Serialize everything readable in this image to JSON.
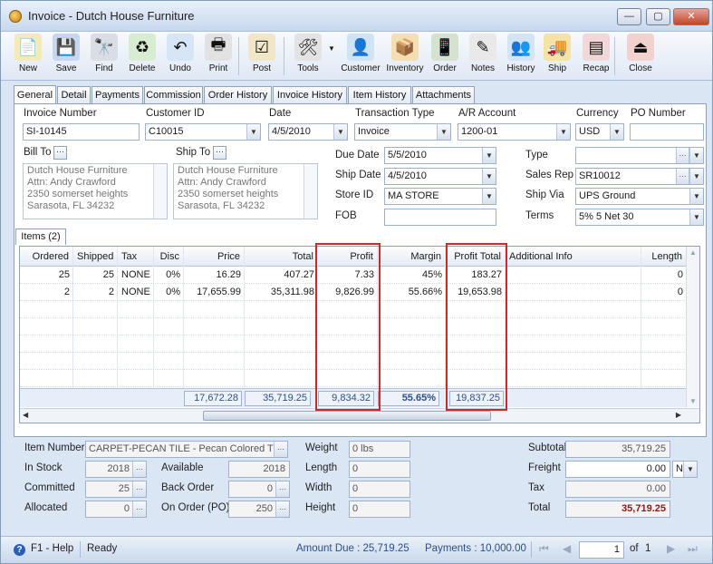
{
  "window": {
    "title": "Invoice - Dutch House Furniture",
    "min": "—",
    "max": "▢",
    "close": "✕"
  },
  "toolbar": [
    {
      "label": "New",
      "icon": "new-doc-icon",
      "glyph": "📄",
      "bg": "#f4e9b8"
    },
    {
      "label": "Save",
      "icon": "save-disk-icon",
      "glyph": "💾",
      "bg": "#c9d6f2"
    },
    {
      "label": "Find",
      "icon": "binoculars-icon",
      "glyph": "🔭",
      "bg": "#d9dde4"
    },
    {
      "label": "Delete",
      "icon": "recycle-bin-icon",
      "glyph": "♻",
      "bg": "#d8ecd2"
    },
    {
      "label": "Undo",
      "icon": "undo-arrow-icon",
      "glyph": "↶",
      "bg": "#d6e6f7"
    },
    {
      "label": "Print",
      "icon": "printer-icon",
      "glyph": "🖶",
      "bg": "#e2e2e2"
    },
    {
      "label": "Post",
      "icon": "post-checklist-icon",
      "glyph": "☑",
      "bg": "#f1e6c8"
    },
    {
      "label": "Tools",
      "icon": "tools-icon",
      "glyph": "🛠",
      "bg": "#e3e3e3"
    },
    {
      "label": "Customer",
      "icon": "customer-person-icon",
      "glyph": "👤",
      "bg": "#cfe3f5"
    },
    {
      "label": "Inventory",
      "icon": "inventory-boxes-icon",
      "glyph": "📦",
      "bg": "#f3dfb2"
    },
    {
      "label": "Order",
      "icon": "order-device-icon",
      "glyph": "📱",
      "bg": "#d5e2d0"
    },
    {
      "label": "Notes",
      "icon": "notes-pen-icon",
      "glyph": "✎",
      "bg": "#e9e9e9"
    },
    {
      "label": "History",
      "icon": "history-person-icon",
      "glyph": "👥",
      "bg": "#d3e5f4"
    },
    {
      "label": "Ship",
      "icon": "forklift-icon",
      "glyph": "🚚",
      "bg": "#f4e3a5"
    },
    {
      "label": "Recap",
      "icon": "recap-report-icon",
      "glyph": "▤",
      "bg": "#f1d7d7"
    },
    {
      "label": "Close",
      "icon": "close-door-icon",
      "glyph": "⏏",
      "bg": "#f2d2cf"
    }
  ],
  "tabs": [
    "General",
    "Detail",
    "Payments",
    "Commission",
    "Order History",
    "Invoice History",
    "Item History",
    "Attachments"
  ],
  "header": {
    "invoice_number_label": "Invoice Number",
    "invoice_number": "SI-10145",
    "customer_id_label": "Customer ID",
    "customer_id": "C10015",
    "date_label": "Date",
    "date": "4/5/2010",
    "transaction_type_label": "Transaction Type",
    "transaction_type": "Invoice",
    "ar_account_label": "A/R Account",
    "ar_account": "1200-01",
    "currency_label": "Currency",
    "currency": "USD",
    "po_number_label": "PO Number",
    "po_number": ""
  },
  "bill_to": {
    "label": "Bill To",
    "lines": [
      "Dutch House Furniture",
      "Attn: Andy Crawford",
      "2350 somerset heights",
      "Sarasota, FL 34232"
    ]
  },
  "ship_to": {
    "label": "Ship To",
    "lines": [
      "Dutch House Furniture",
      "Attn: Andy Crawford",
      "2350 somerset heights",
      "Sarasota, FL 34232"
    ]
  },
  "dates": {
    "due_date_label": "Due Date",
    "due_date": "5/5/2010",
    "ship_date_label": "Ship Date",
    "ship_date": "4/5/2010",
    "store_id_label": "Store ID",
    "store_id": "MA STORE",
    "fob_label": "FOB",
    "fob": ""
  },
  "terms": {
    "type_label": "Type",
    "type": "",
    "sales_rep_label": "Sales Rep",
    "sales_rep": "SR10012",
    "ship_via_label": "Ship Via",
    "ship_via": "UPS Ground",
    "terms_label": "Terms",
    "terms": "5% 5 Net 30"
  },
  "items_tab": "Items (2)",
  "grid": {
    "columns": [
      "Ordered",
      "Shipped",
      "Tax",
      "Disc",
      "Price",
      "Total",
      "Profit",
      "Margin",
      "Profit Total",
      "Additional Info",
      "Length"
    ],
    "rows": [
      [
        "25",
        "25",
        "NONE",
        "0%",
        "16.29",
        "407.27",
        "7.33",
        "45%",
        "183.27",
        "",
        "0"
      ],
      [
        "2",
        "2",
        "NONE",
        "0%",
        "17,655.99",
        "35,311.98",
        "9,826.99",
        "55.66%",
        "19,653.98",
        "",
        "0"
      ]
    ],
    "totals": {
      "price": "17,672.28",
      "total": "35,719.25",
      "profit": "9,834.32",
      "margin": "55.65%",
      "profit_total": "19,837.25"
    }
  },
  "item_info": {
    "item_number_label": "Item Number",
    "item_number": "CARPET-PECAN TILE - Pecan Colored Tiles",
    "in_stock_label": "In Stock",
    "in_stock": "2018",
    "available_label": "Available",
    "available": "2018",
    "committed_label": "Committed",
    "committed": "25",
    "back_order_label": "Back Order",
    "back_order": "0",
    "allocated_label": "Allocated",
    "allocated": "0",
    "on_order_label": "On Order (PO)",
    "on_order": "250",
    "weight_label": "Weight",
    "weight": "0 lbs",
    "length_label": "Length",
    "length": "0",
    "width_label": "Width",
    "width": "0",
    "height_label": "Height",
    "height": "0"
  },
  "summary": {
    "subtotal_label": "Subtotal",
    "subtotal": "35,719.25",
    "freight_label": "Freight",
    "freight": "0.00",
    "freight_code": "N",
    "tax_label": "Tax",
    "tax": "0.00",
    "total_label": "Total",
    "total": "35,719.25"
  },
  "statusbar": {
    "help": "F1 - Help",
    "state": "Ready",
    "amount_due": "Amount Due : 25,719.25",
    "payments": "Payments : 10,000.00",
    "page": "1",
    "of_label": "of",
    "page_count": "1"
  }
}
